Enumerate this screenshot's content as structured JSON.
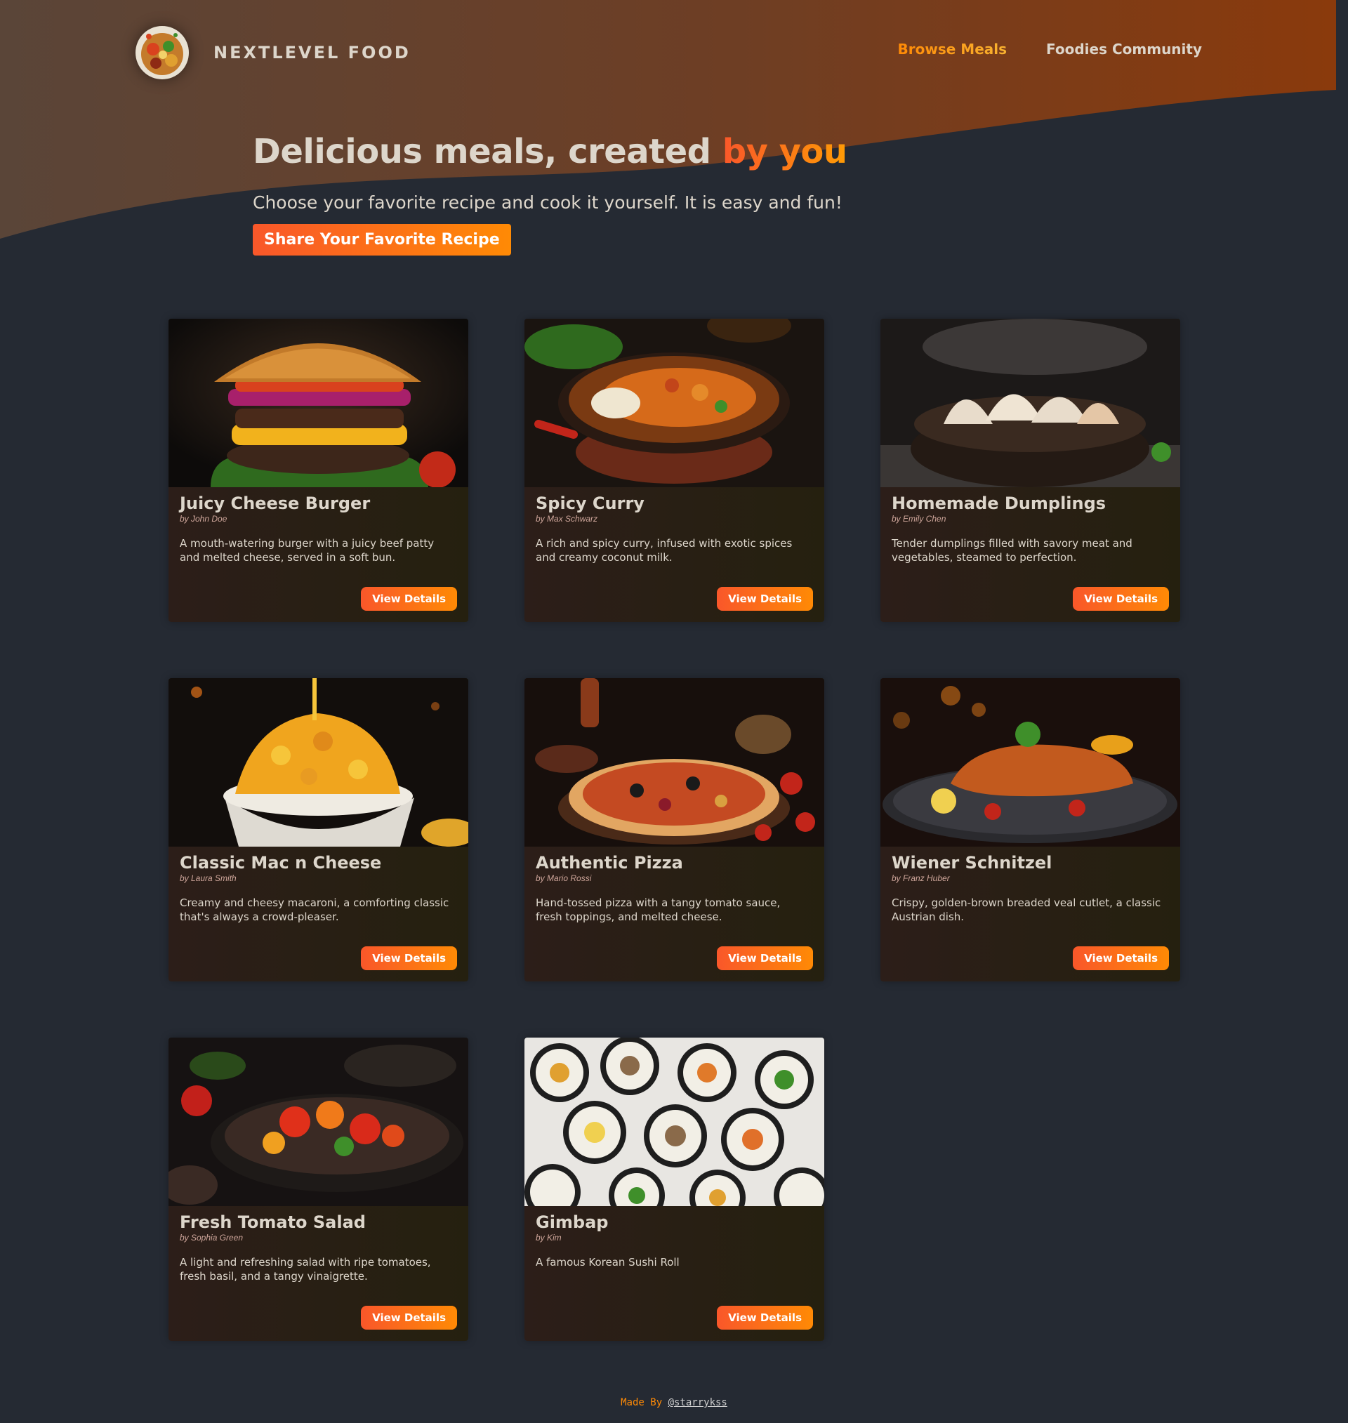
{
  "brand": {
    "name": "NextLevel Food",
    "logo_icon": "food-plate-logo-icon"
  },
  "nav": {
    "items": [
      {
        "label": "Browse Meals",
        "active": true
      },
      {
        "label": "Foodies Community",
        "active": false
      }
    ]
  },
  "hero": {
    "title_prefix": "Delicious meals, created ",
    "title_highlight": "by you",
    "subtitle": "Choose your favorite recipe and cook it yourself. It is easy and fun!",
    "cta_label": "Share Your Favorite Recipe"
  },
  "meals": [
    {
      "title": "Juicy Cheese Burger",
      "creator": "by John Doe",
      "summary": "A mouth-watering burger with a juicy beef patty and melted cheese, served in a soft bun.",
      "action": "View Details",
      "image_icon": "burger-photo"
    },
    {
      "title": "Spicy Curry",
      "creator": "by Max Schwarz",
      "summary": "A rich and spicy curry, infused with exotic spices and creamy coconut milk.",
      "action": "View Details",
      "image_icon": "curry-photo"
    },
    {
      "title": "Homemade Dumplings",
      "creator": "by Emily Chen",
      "summary": "Tender dumplings filled with savory meat and vegetables, steamed to perfection.",
      "action": "View Details",
      "image_icon": "dumplings-photo"
    },
    {
      "title": "Classic Mac n Cheese",
      "creator": "by Laura Smith",
      "summary": "Creamy and cheesy macaroni, a comforting classic that's always a crowd-pleaser.",
      "action": "View Details",
      "image_icon": "mac-cheese-photo"
    },
    {
      "title": "Authentic Pizza",
      "creator": "by Mario Rossi",
      "summary": "Hand-tossed pizza with a tangy tomato sauce, fresh toppings, and melted cheese.",
      "action": "View Details",
      "image_icon": "pizza-photo"
    },
    {
      "title": "Wiener Schnitzel",
      "creator": "by Franz Huber",
      "summary": "Crispy, golden-brown breaded veal cutlet, a classic Austrian dish.",
      "action": "View Details",
      "image_icon": "schnitzel-photo"
    },
    {
      "title": "Fresh Tomato Salad",
      "creator": "by Sophia Green",
      "summary": "A light and refreshing salad with ripe tomatoes, fresh basil, and a tangy vinaigrette.",
      "action": "View Details",
      "image_icon": "tomato-salad-photo"
    },
    {
      "title": "Gimbap",
      "creator": "by Kim",
      "summary": "A famous Korean Sushi Roll",
      "action": "View Details",
      "image_icon": "gimbap-photo"
    }
  ],
  "footer": {
    "prefix": "Made By ",
    "link": "@starrykss"
  },
  "colors": {
    "page_bg": "#252a33",
    "header_gradient_start": "#5a4238",
    "header_gradient_end": "#8a3a0c",
    "accent_start": "#f9572a",
    "accent_end": "#ff8a05",
    "text": "#ddd6cb"
  }
}
